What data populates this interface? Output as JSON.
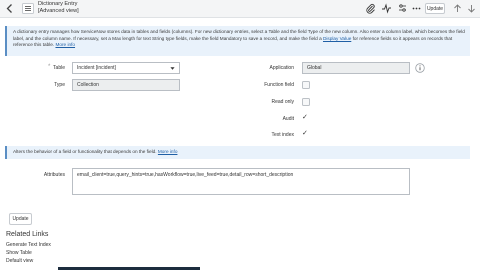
{
  "header": {
    "title_line1": "Dictionary Entry",
    "title_line2": "[Advanced view]",
    "update_label": "Update"
  },
  "info_top": {
    "text": "A dictionary entry manages how ServiceNow stores data in tables and fields (columns). For new dictionary entries, select a Table and the field Type of the new column. Also enter a column label, which becomes the field label, and the column name. If necessary, set a Max length for text String type fields, make the field Mandatory to save a record, and make the field a",
    "display_value_link": "Display Value",
    "text_after": "for reference fields so it appears on records that reference this table.",
    "more_info": "More info"
  },
  "form": {
    "table_label": "Table",
    "table_value": "Incident [incident]",
    "type_label": "Type",
    "type_value": "Collection",
    "application_label": "Application",
    "application_value": "Global",
    "function_field_label": "Function field",
    "function_field_checked": false,
    "read_only_label": "Read only",
    "read_only_checked": false,
    "audit_label": "Audit",
    "audit_checked": true,
    "text_index_label": "Text index",
    "text_index_checked": true
  },
  "info_mid": {
    "text": "Alters the behavior of a field or functionality that depends on the field.",
    "more_info": "More info"
  },
  "attributes": {
    "label": "Attributes",
    "value": "email_client=true,query_hints=true,hasWorkflow=true,live_feed=true,detail_row=short_description"
  },
  "footer": {
    "update_label": "Update",
    "related_links_title": "Related Links",
    "links": [
      "Generate Text Index",
      "Show Table",
      "Default view"
    ]
  },
  "colors": {
    "info_bg": "#e9f2fb",
    "link": "#1f5fa5"
  }
}
